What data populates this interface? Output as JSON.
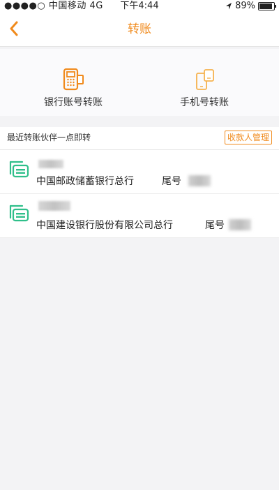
{
  "status_bar": {
    "carrier": "●●●●○ 中国移动  4G",
    "time": "下午4:44",
    "battery": "89%",
    "battery_level": 0.89
  },
  "nav": {
    "title": "转账"
  },
  "options": [
    {
      "label": "银行账号转账",
      "icon": "bank-card-terminal-icon"
    },
    {
      "label": "手机号转账",
      "icon": "phone-transfer-icon"
    }
  ],
  "section": {
    "title": "最近转账伙伴一点即转",
    "manage_label": "收款人管理"
  },
  "payees": [
    {
      "bank": "中国邮政储蓄银行总行",
      "tail_label": "尾号",
      "icon": "bank-card-icon"
    },
    {
      "bank": "中国建设银行股份有限公司总行",
      "tail_label": "尾号",
      "icon": "bank-card-icon"
    }
  ],
  "colors": {
    "accent": "#f08a1c",
    "card_icon": "#2fbf8a",
    "background": "#f3f3f5"
  }
}
